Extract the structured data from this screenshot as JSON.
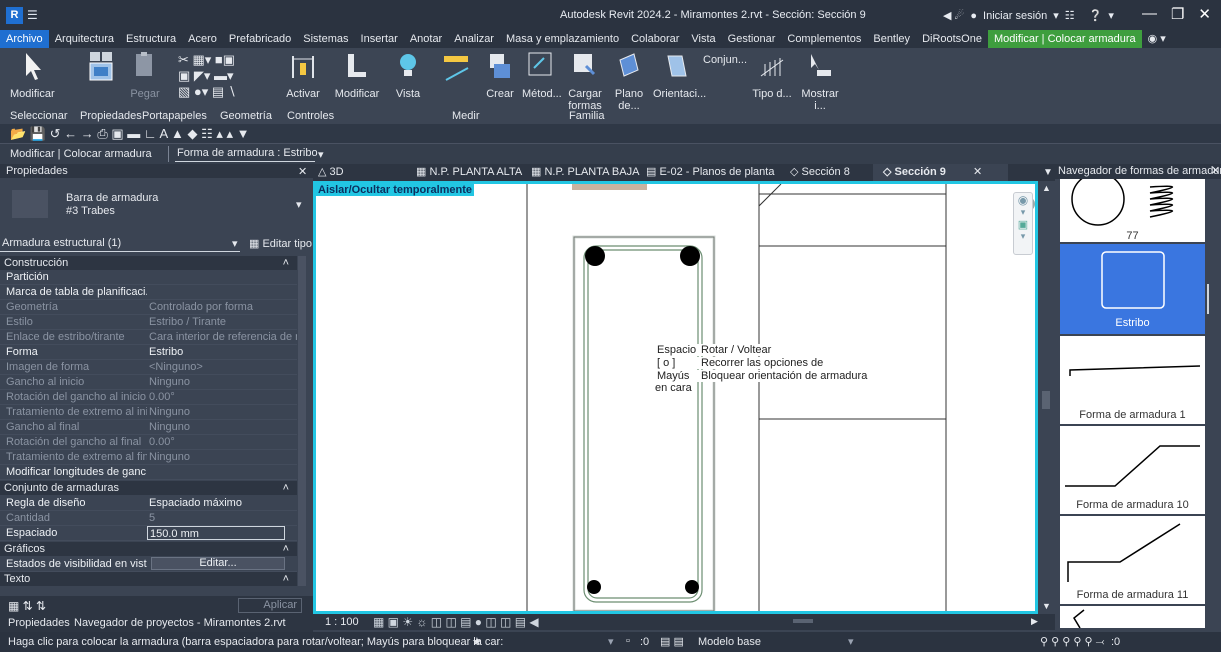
{
  "title": "Autodesk Revit 2024.2 - Miramontes 2.rvt - Sección: Sección 9",
  "titlebar": {
    "logo": "R",
    "signin": "Iniciar sesión"
  },
  "menu": [
    "Archivo",
    "Arquitectura",
    "Estructura",
    "Acero",
    "Prefabricado",
    "Sistemas",
    "Insertar",
    "Anotar",
    "Analizar",
    "Masa y emplazamiento",
    "Colaborar",
    "Vista",
    "Gestionar",
    "Complementos",
    "Bentley",
    "DiRootsOne",
    "Modificar | Colocar armadura"
  ],
  "ribbon": {
    "buttons": {
      "modificar": "Modificar",
      "pegar": "Pegar",
      "activar": "Activar",
      "modificar2": "Modificar",
      "vista": "Vista",
      "crear": "Crear",
      "metodo": "Métod...",
      "cargar": "Cargar formas",
      "plano": "Plano de...",
      "orient": "Orientaci...",
      "conjun": "Conjun...",
      "tipod": "Tipo d...",
      "mostrar": "Mostrar i..."
    },
    "panels": {
      "seleccionar": "Seleccionar",
      "propiedades": "Propiedades",
      "portapapeles": "Portapapeles",
      "geometria": "Geometría",
      "controles": "Controles",
      "medir": "Medir",
      "familia": "Familia"
    }
  },
  "optbar": {
    "context": "Modificar | Colocar armadura",
    "shape_select": "Forma de armadura : Estribo"
  },
  "properties": {
    "header": "Propiedades",
    "type_line1": "Barra de armadura",
    "type_line2": "#3 Trabes",
    "filter": "Armadura estructural (1)",
    "edit_type": "Editar tipo",
    "sections": {
      "construccion": "Construcción",
      "conjunto": "Conjunto de armaduras",
      "graficos": "Gráficos",
      "texto": "Texto"
    },
    "rows": [
      {
        "k": "Partición",
        "v": "",
        "dim": false
      },
      {
        "k": "Marca de tabla de planificaci...",
        "v": "",
        "dim": false
      },
      {
        "k": "Geometría",
        "v": "Controlado por forma",
        "dim": true
      },
      {
        "k": "Estilo",
        "v": "Estribo / Tirante",
        "dim": true
      },
      {
        "k": "Enlace de estribo/tirante",
        "v": "Cara interior de referencia de r...",
        "dim": true
      },
      {
        "k": "Forma",
        "v": "Estribo",
        "dim": false
      },
      {
        "k": "Imagen de forma",
        "v": "<Ninguno>",
        "dim": true
      },
      {
        "k": "Gancho al inicio",
        "v": "Ninguno",
        "dim": true
      },
      {
        "k": "Rotación del gancho al inicio",
        "v": "0.00°",
        "dim": true
      },
      {
        "k": "Tratamiento de extremo al ini...",
        "v": "Ninguno",
        "dim": true
      },
      {
        "k": "Gancho al final",
        "v": "Ninguno",
        "dim": true
      },
      {
        "k": "Rotación del gancho al final",
        "v": "0.00°",
        "dim": true
      },
      {
        "k": "Tratamiento de extremo al fin...",
        "v": "Ninguno",
        "dim": true
      },
      {
        "k": "Modificar longitudes de ganc...",
        "v": "",
        "dim": false
      }
    ],
    "rows2": [
      {
        "k": "Regla de diseño",
        "v": "Espaciado máximo",
        "dim": false
      },
      {
        "k": "Cantidad",
        "v": "5",
        "dim": true
      },
      {
        "k": "Espaciado",
        "v": "150.0 mm",
        "dim": false
      }
    ],
    "vis_key": "Estados de visibilidad en vista",
    "vis_btn": "Editar...",
    "apply": "Aplicar"
  },
  "view_tabs": [
    "3D",
    "N.P. PLANTA ALTA",
    "N.P. PLANTA BAJA",
    "E-02 - Planos de planta",
    "Sección 8",
    "Sección 9"
  ],
  "canvas": {
    "temp_label": "Aislar/Ocultar temporalmente",
    "tips": [
      {
        "key": "Espacio",
        "desc": "Rotar / Voltear"
      },
      {
        "key": "[ o ]",
        "desc": "Recorrer las opciones de orientación"
      },
      {
        "key": "Mayús",
        "desc": "Bloquear orientación de armadura en cara"
      }
    ]
  },
  "view_control": {
    "scale": "1 : 100"
  },
  "browser": {
    "header": "Navegador de formas de armadura",
    "items": [
      "77",
      "Estribo",
      "Forma de armadura 1",
      "Forma de armadura 10",
      "Forma de armadura 11"
    ]
  },
  "bottom_tabs": [
    "Propiedades",
    "Navegador de proyectos - Miramontes 2.rvt"
  ],
  "status": {
    "message": "Haga clic para colocar la armadura (barra espaciadora para rotar/voltear; Mayús para bloquear la car:",
    "zero": ":0",
    "model": "Modelo base",
    "filter_zero": ":0"
  }
}
